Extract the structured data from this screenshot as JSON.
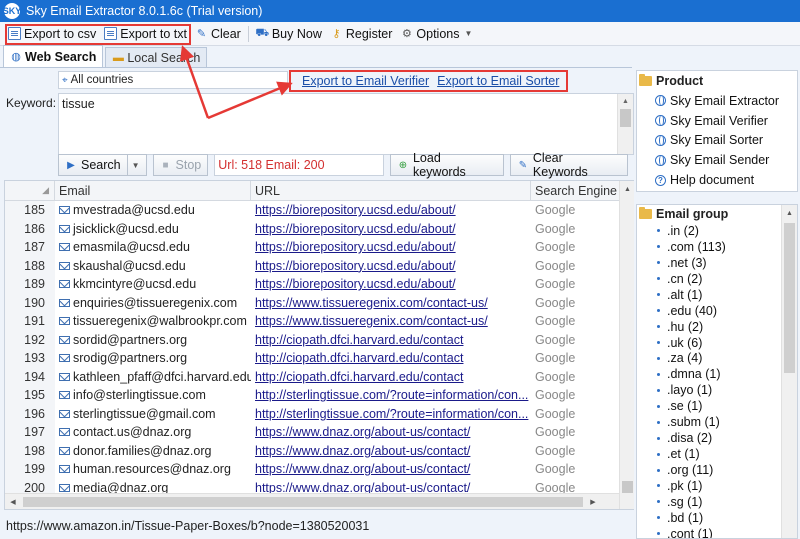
{
  "window": {
    "title": "Sky Email Extractor 8.0.1.6c (Trial version)",
    "icon_text": "SKY"
  },
  "toolbar": {
    "export_csv": "Export to csv",
    "export_txt": "Export to txt",
    "clear": "Clear",
    "buy_now": "Buy Now",
    "register": "Register",
    "options": "Options"
  },
  "tabs": [
    {
      "label": "Web Search",
      "active": true
    },
    {
      "label": "Local Search",
      "active": false
    }
  ],
  "search": {
    "country": "All countries",
    "export_verifier": "Export to Email Verifier",
    "export_sorter": "Export to Email Sorter",
    "keyword_label": "Keyword:",
    "keyword_value": "tissue",
    "search_button": "Search",
    "stop_button": "Stop",
    "status": "Url: 518 Email: 200",
    "load_keywords": "Load keywords",
    "clear_keywords": "Clear Keywords"
  },
  "grid": {
    "columns": [
      "Email",
      "URL",
      "Search Engine"
    ],
    "rows": [
      {
        "n": "185",
        "email": "mvestrada@ucsd.edu",
        "url": "https://biorepository.ucsd.edu/about/",
        "engine": "Google"
      },
      {
        "n": "186",
        "email": "jsicklick@ucsd.edu",
        "url": "https://biorepository.ucsd.edu/about/",
        "engine": "Google"
      },
      {
        "n": "187",
        "email": "emasmila@ucsd.edu",
        "url": "https://biorepository.ucsd.edu/about/",
        "engine": "Google"
      },
      {
        "n": "188",
        "email": "skaushal@ucsd.edu",
        "url": "https://biorepository.ucsd.edu/about/",
        "engine": "Google"
      },
      {
        "n": "189",
        "email": "kkmcintyre@ucsd.edu",
        "url": "https://biorepository.ucsd.edu/about/",
        "engine": "Google"
      },
      {
        "n": "190",
        "email": "enquiries@tissueregenix.com",
        "url": "https://www.tissueregenix.com/contact-us/",
        "engine": "Google"
      },
      {
        "n": "191",
        "email": "tissueregenix@walbrookpr.com",
        "url": "https://www.tissueregenix.com/contact-us/",
        "engine": "Google"
      },
      {
        "n": "192",
        "email": "sordid@partners.org",
        "url": "http://ciopath.dfci.harvard.edu/contact",
        "engine": "Google"
      },
      {
        "n": "193",
        "email": "srodig@partners.org",
        "url": "http://ciopath.dfci.harvard.edu/contact",
        "engine": "Google"
      },
      {
        "n": "194",
        "email": "kathleen_pfaff@dfci.harvard.edu",
        "url": "http://ciopath.dfci.harvard.edu/contact",
        "engine": "Google"
      },
      {
        "n": "195",
        "email": "info@sterlingtissue.com",
        "url": "http://sterlingtissue.com/?route=information/con...",
        "engine": "Google"
      },
      {
        "n": "196",
        "email": "sterlingtissue@gmail.com",
        "url": "http://sterlingtissue.com/?route=information/con...",
        "engine": "Google"
      },
      {
        "n": "197",
        "email": "contact.us@dnaz.org",
        "url": "https://www.dnaz.org/about-us/contact/",
        "engine": "Google"
      },
      {
        "n": "198",
        "email": "donor.families@dnaz.org",
        "url": "https://www.dnaz.org/about-us/contact/",
        "engine": "Google"
      },
      {
        "n": "199",
        "email": "human.resources@dnaz.org",
        "url": "https://www.dnaz.org/about-us/contact/",
        "engine": "Google"
      },
      {
        "n": "200",
        "email": "media@dnaz.org",
        "url": "https://www.dnaz.org/about-us/contact/",
        "engine": "Google"
      }
    ]
  },
  "statusbar": {
    "text": "https://www.amazon.in/Tissue-Paper-Boxes/b?node=1380520031"
  },
  "product": {
    "title": "Product",
    "items": [
      "Sky Email Extractor",
      "Sky Email Verifier",
      "Sky Email Sorter",
      "Sky Email Sender",
      "Help document"
    ]
  },
  "email_group": {
    "title": "Email group",
    "items": [
      ".in (2)",
      ".com (113)",
      ".net (3)",
      ".cn (2)",
      ".alt (1)",
      ".edu (40)",
      ".hu (2)",
      ".uk (6)",
      ".za (4)",
      ".dmna (1)",
      ".layo (1)",
      ".se (1)",
      ".subm (1)",
      ".disa (2)",
      ".et (1)",
      ".org (11)",
      ".pk (1)",
      ".sg (1)",
      ".bd (1)",
      ".cont (1)"
    ]
  },
  "colors": {
    "title_bar": "#1a6fd1",
    "highlight": "#e53935",
    "status_text": "#d32f2f",
    "link": "#1a4ea8"
  }
}
